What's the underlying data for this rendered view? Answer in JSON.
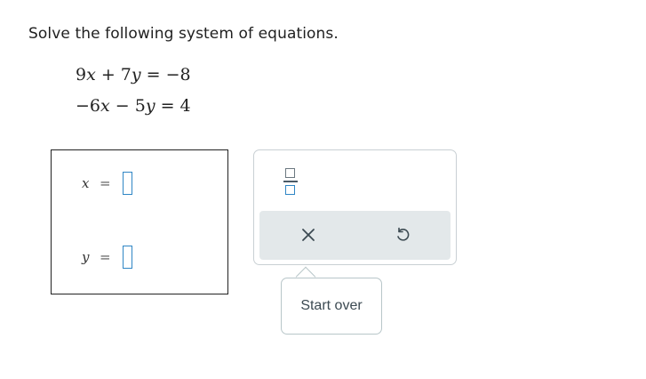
{
  "question": {
    "prompt": "Solve the following system of equations.",
    "equations": [
      "9x+7y=−8",
      "−6x−5y=4"
    ]
  },
  "answers": {
    "x_label": "x",
    "y_label": "y",
    "equals": "=",
    "x_value": "",
    "y_value": ""
  },
  "toolbar": {
    "fraction_icon": "fraction-icon",
    "clear_icon": "close-icon",
    "undo_icon": "undo-icon",
    "accent": "#2f86c5",
    "bar_color": "#e3e8ea"
  },
  "tooltip": {
    "text": "Start over"
  }
}
